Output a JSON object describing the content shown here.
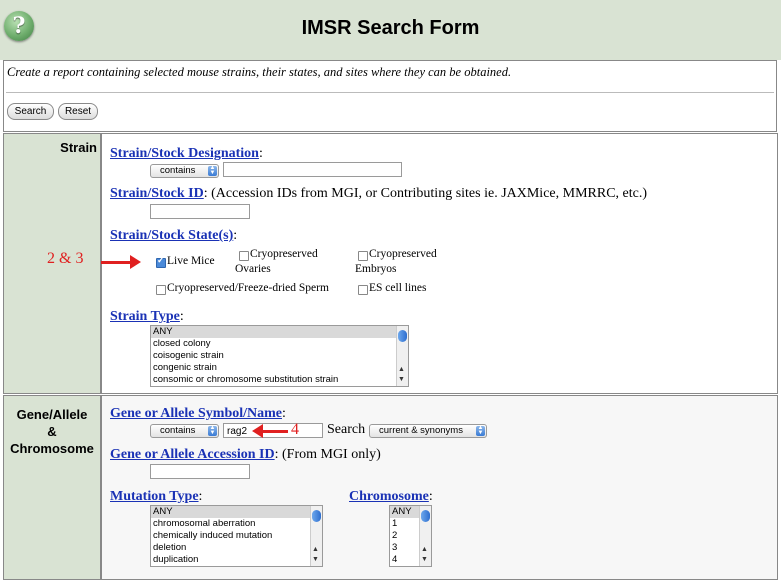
{
  "header": {
    "title": "IMSR Search Form",
    "help_icon": "help-question-icon"
  },
  "intro": {
    "text": "Create a report containing selected mouse strains, their states, and sites where they can be obtained.",
    "search_label": "Search",
    "reset_label": "Reset"
  },
  "strain": {
    "section_label": "Strain",
    "designation": {
      "label": "Strain/Stock Designation",
      "suffix": ":",
      "operator": "contains",
      "value": ""
    },
    "id": {
      "label": "Strain/Stock ID",
      "suffix": ":",
      "note": "(Accession IDs from MGI, or Contributing sites ie. JAXMice, MMRRC, etc.)",
      "value": ""
    },
    "state": {
      "label": "Strain/Stock State(s)",
      "suffix": ":",
      "options": [
        {
          "label": "Live Mice",
          "checked": true
        },
        {
          "label": "Cryopreserved",
          "label2": "Ovaries",
          "checked": false
        },
        {
          "label": "Cryopreserved",
          "label2": "Embryos",
          "checked": false
        },
        {
          "label": "Cryopreserved/Freeze-dried Sperm",
          "checked": false
        },
        {
          "label": "ES cell lines",
          "checked": false
        }
      ]
    },
    "type": {
      "label": "Strain Type",
      "suffix": ":",
      "items": [
        "ANY",
        "closed colony",
        "coisogenic strain",
        "congenic strain",
        "consomic or chromosome substitution strain"
      ],
      "selected": "ANY"
    }
  },
  "gene": {
    "section_label": [
      "Gene/Allele",
      "&",
      "Chromosome"
    ],
    "symbol": {
      "label": "Gene or Allele Symbol/Name",
      "suffix": ":",
      "operator": "contains",
      "value": "rag2",
      "search_label": "Search",
      "search_scope": "current & synonyms"
    },
    "accession": {
      "label": "Gene or Allele Accession ID",
      "suffix": ":",
      "note": "(From MGI only)",
      "value": ""
    },
    "mutation": {
      "label": "Mutation Type",
      "suffix": ":",
      "items": [
        "ANY",
        "chromosomal aberration",
        "chemically induced mutation",
        "deletion",
        "duplication"
      ],
      "selected": "ANY"
    },
    "chromosome": {
      "label": "Chromosome",
      "suffix": ":",
      "items": [
        "ANY",
        "1",
        "2",
        "3",
        "4"
      ],
      "selected": "ANY"
    }
  },
  "annotations": {
    "state_marker": "2 & 3",
    "gene_marker": "4",
    "color": "#e02020"
  },
  "colors": {
    "section_bg": "#d9e3d3",
    "link": "#1a32b5"
  }
}
